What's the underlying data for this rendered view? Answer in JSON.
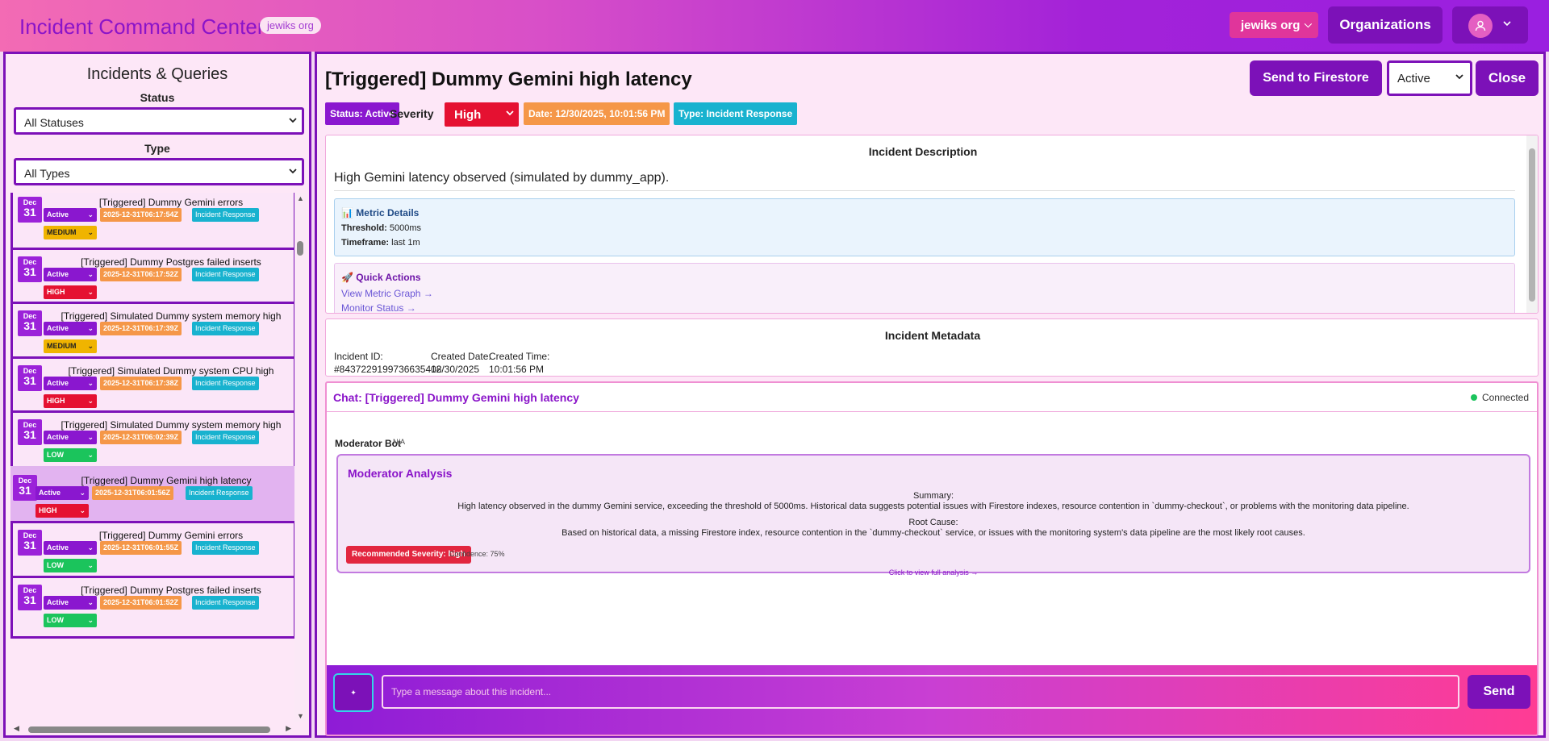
{
  "header": {
    "app_title": "Incident Command Center",
    "org_chip": "jewiks org",
    "org_select_value": "jewiks org",
    "organizations_label": "Organizations"
  },
  "sidebar": {
    "title": "Incidents & Queries",
    "status_label": "Status",
    "status_filter": "All Statuses",
    "type_label": "Type",
    "type_filter": "All Types",
    "items": [
      {
        "month": "Dec",
        "day": "31",
        "title": "[Triggered] Dummy Gemini errors",
        "status": "Active",
        "time": "2025-12-31T06:17:54Z",
        "type": "Incident Response",
        "severity": "MEDIUM"
      },
      {
        "month": "Dec",
        "day": "31",
        "title": "[Triggered] Dummy Postgres failed inserts",
        "status": "Active",
        "time": "2025-12-31T06:17:52Z",
        "type": "Incident Response",
        "severity": "HIGH"
      },
      {
        "month": "Dec",
        "day": "31",
        "title": "[Triggered] Simulated Dummy system memory high",
        "status": "Active",
        "time": "2025-12-31T06:17:39Z",
        "type": "Incident Response",
        "severity": "MEDIUM"
      },
      {
        "month": "Dec",
        "day": "31",
        "title": "[Triggered] Simulated Dummy system CPU high",
        "status": "Active",
        "time": "2025-12-31T06:17:38Z",
        "type": "Incident Response",
        "severity": "HIGH"
      },
      {
        "month": "Dec",
        "day": "31",
        "title": "[Triggered] Simulated Dummy system memory high",
        "status": "Active",
        "time": "2025-12-31T06:02:39Z",
        "type": "Incident Response",
        "severity": "LOW"
      },
      {
        "month": "Dec",
        "day": "31",
        "title": "[Triggered] Dummy Gemini high latency",
        "status": "Active",
        "time": "2025-12-31T06:01:56Z",
        "type": "Incident Response",
        "severity": "HIGH"
      },
      {
        "month": "Dec",
        "day": "31",
        "title": "[Triggered] Dummy Gemini errors",
        "status": "Active",
        "time": "2025-12-31T06:01:55Z",
        "type": "Incident Response",
        "severity": "LOW"
      },
      {
        "month": "Dec",
        "day": "31",
        "title": "[Triggered] Dummy Postgres failed inserts",
        "status": "Active",
        "time": "2025-12-31T06:01:52Z",
        "type": "Incident Response",
        "severity": "LOW"
      }
    ],
    "selected_index": 5
  },
  "incident": {
    "title": "[Triggered] Dummy Gemini high latency",
    "send_firestore_label": "Send to Firestore",
    "status_value": "Active",
    "close_label": "Close",
    "status_tag": "Status: Active",
    "severity_label": "Severity",
    "severity_value": "High",
    "date_tag": "Date: 12/30/2025, 10:01:56 PM",
    "type_tag": "Type: Incident Response"
  },
  "description": {
    "heading": "Incident Description",
    "text": "High Gemini latency observed (simulated by dummy_app).",
    "metric_heading": "Metric Details",
    "threshold_label": "Threshold:",
    "threshold_value": "5000ms",
    "timeframe_label": "Timeframe:",
    "timeframe_value": "last 1m",
    "quick_heading": "Quick Actions",
    "action_graph": "View Metric Graph →",
    "action_monitor": "Monitor Status →"
  },
  "metadata": {
    "heading": "Incident Metadata",
    "id_label": "Incident ID:",
    "id_value": "#8437229199736635408",
    "created_date_label": "Created Date:",
    "created_date_value": "12/30/2025",
    "created_time_label": "Created Time:",
    "created_time_value": "10:01:56 PM"
  },
  "chat": {
    "title": "Chat: [Triggered] Dummy Gemini high latency",
    "connection": "Connected",
    "author": "Moderator Bot",
    "author_meta": "N/A",
    "analysis_heading": "Moderator Analysis",
    "summary_label": "Summary:",
    "summary_text": "High latency observed in the dummy Gemini service, exceeding the threshold of 5000ms. Historical data suggests potential issues with Firestore indexes, resource contention in `dummy-checkout`, or problems with the monitoring data pipeline.",
    "root_cause_label": "Root Cause:",
    "root_cause_text": "Based on historical data, a missing Firestore index, resource contention in the `dummy-checkout` service, or issues with the monitoring system's data pipeline are the most likely root causes.",
    "recommended": "Recommended Severity: high",
    "confidence": "Confidence: 75%",
    "full_link": "Click to view full analysis →",
    "mic_glyph": "✦",
    "input_placeholder": "Type a message about this incident...",
    "send_label": "Send"
  },
  "colors": {
    "accent": "#7c11b8",
    "high": "#e51131",
    "medium": "#f0b400",
    "low": "#1bc45c",
    "time": "#f59748",
    "type": "#18b2cf"
  }
}
